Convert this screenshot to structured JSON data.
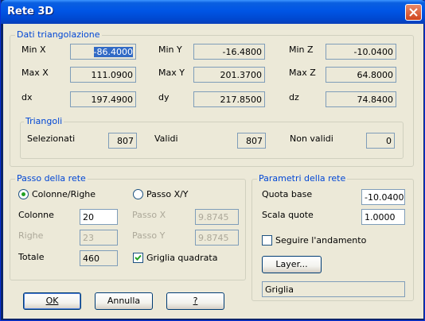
{
  "window": {
    "title": "Rete 3D"
  },
  "triangolazione": {
    "legend": "Dati triangolazione",
    "min_x_label": "Min X",
    "min_x": "-86.4000",
    "min_y_label": "Min Y",
    "min_y": "-16.4800",
    "min_z_label": "Min Z",
    "min_z": "-10.0400",
    "max_x_label": "Max X",
    "max_x": "111.0900",
    "max_y_label": "Max Y",
    "max_y": "201.3700",
    "max_z_label": "Max Z",
    "max_z": "64.8000",
    "dx_label": "dx",
    "dx": "197.4900",
    "dy_label": "dy",
    "dy": "217.8500",
    "dz_label": "dz",
    "dz": "74.8400",
    "triangoli": {
      "legend": "Triangoli",
      "selezionati_label": "Selezionati",
      "selezionati": "807",
      "validi_label": "Validi",
      "validi": "807",
      "non_validi_label": "Non validi",
      "non_validi": "0"
    }
  },
  "passo": {
    "legend": "Passo della rete",
    "radio_colonne_righe": "Colonne/Righe",
    "radio_passo_xy": "Passo X/Y",
    "selected_mode": "Colonne/Righe",
    "colonne_label": "Colonne",
    "colonne": "20",
    "righe_label": "Righe",
    "righe": "23",
    "totale_label": "Totale",
    "totale": "460",
    "passo_x_label": "Passo X",
    "passo_x": "9.8745",
    "passo_y_label": "Passo Y",
    "passo_y": "9.8745",
    "griglia_quadrata_label": "Griglia quadrata",
    "griglia_quadrata_checked": true
  },
  "parametri": {
    "legend": "Parametri della rete",
    "quota_base_label": "Quota base",
    "quota_base": "-10.0400",
    "scala_quote_label": "Scala quote",
    "scala_quote": "1.0000",
    "seguire_label": "Seguire l'andamento",
    "seguire_checked": false,
    "layer_button": "Layer...",
    "layer_value": "Griglia"
  },
  "buttons": {
    "ok": "OK",
    "annulla": "Annulla",
    "help": "?"
  },
  "colors": {
    "titlebar": "#0055e5",
    "dialog_bg": "#ece9d8",
    "legend_text": "#0046d5",
    "field_border": "#7f9db9"
  }
}
